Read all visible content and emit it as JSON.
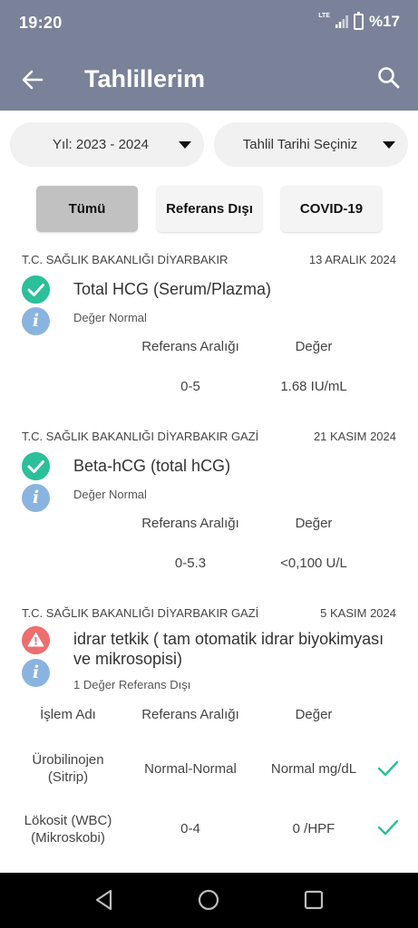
{
  "status_bar": {
    "time": "19:20",
    "network": "LTE",
    "battery": "%17"
  },
  "app_bar": {
    "title": "Tahlillerim"
  },
  "filters": {
    "year_dropdown": "Yıl: 2023 - 2024",
    "date_dropdown": "Tahlil Tarihi Seçiniz",
    "tabs": [
      "Tümü",
      "Referans Dışı",
      "COVID-19"
    ],
    "active_tab": "Tümü"
  },
  "results": [
    {
      "lab": "T.C. SAĞLIK BAKANLIĞI DİYARBAKIR",
      "date": "13 ARALIK 2024",
      "status_icon": "check-circle-icon",
      "test_name": "Total HCG (Serum/Plazma)",
      "status_text": "Değer Normal",
      "headers": [
        "Referans Aralığı",
        "Değer"
      ],
      "rows": [
        {
          "range": "0-5",
          "value": "1.68 IU/mL"
        }
      ]
    },
    {
      "lab": "T.C. SAĞLIK BAKANLIĞI DİYARBAKIR GAZİ",
      "date": "21 KASIM 2024",
      "status_icon": "check-circle-icon",
      "test_name": "Beta-hCG (total hCG)",
      "status_text": "Değer Normal",
      "headers": [
        "Referans Aralığı",
        "Değer"
      ],
      "rows": [
        {
          "range": "0-5.3",
          "value": "<0,100 U/L"
        }
      ]
    },
    {
      "lab": "T.C. SAĞLIK BAKANLIĞI DİYARBAKIR GAZİ",
      "date": "5 KASIM 2024",
      "status_icon": "warning-icon",
      "test_name_line1": "idrar tetkik ( tam otomatik idrar biyokimyası",
      "test_name_line2": "ve mikrosopisi)",
      "status_text": "1 Değer Referans Dışı",
      "headers": [
        "İşlem Adı",
        "Referans Aralığı",
        "Değer"
      ],
      "rows": [
        {
          "name_line1": "Ürobilinojen",
          "name_line2": "(Sitrip)",
          "range": "Normal-Normal",
          "value": "Normal mg/dL"
        },
        {
          "name_line1": "Lökosit (WBC)",
          "name_line2": "(Mikroskobi)",
          "range": "0-4",
          "value": "0 /HPF"
        }
      ]
    }
  ],
  "colors": {
    "header": "#7a8299",
    "ok": "#2bbf9a",
    "warning": "#ed6e6e",
    "info": "#8ab4df"
  }
}
